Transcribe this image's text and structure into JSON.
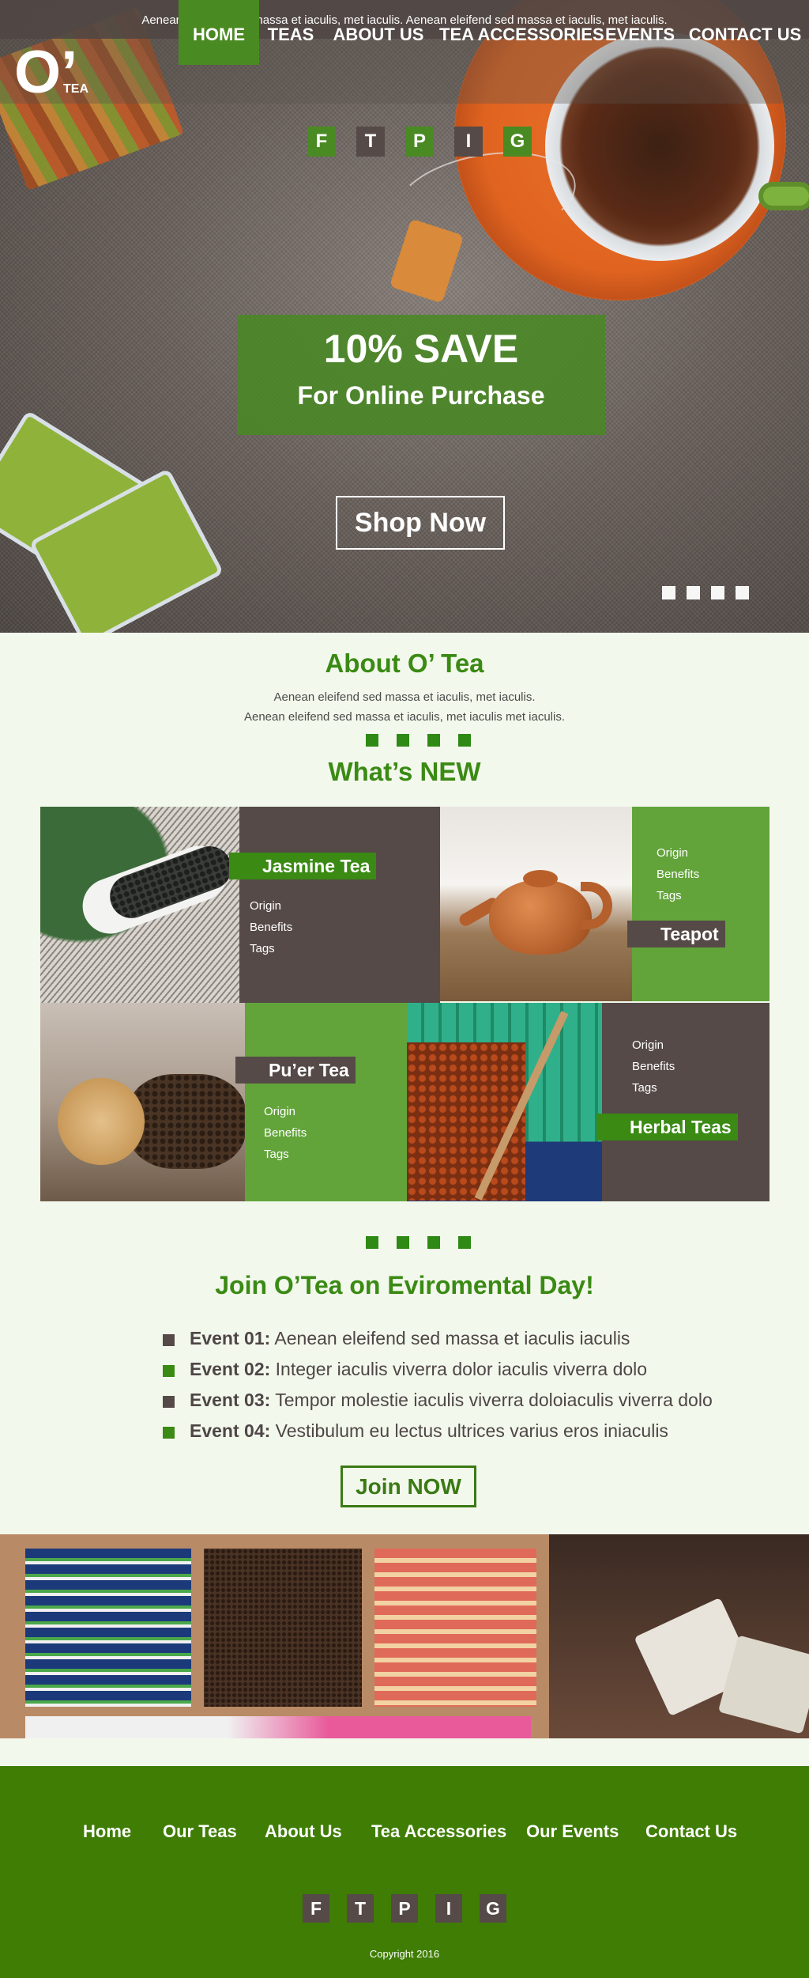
{
  "topbar": {
    "text": "Aenean eleifend sed massa et iaculis, met iaculis. Aenean eleifend sed massa et iaculis, met iaculis."
  },
  "logo": {
    "mark": "O’",
    "word": "TEA"
  },
  "nav": [
    "HOME",
    "TEAS",
    "ABOUT US",
    "TEA ACCESSORIES",
    "EVENTS",
    "CONTACT US"
  ],
  "nav_active": "HOME",
  "social": [
    "F",
    "T",
    "P",
    "I",
    "G"
  ],
  "hero": {
    "promo_big": "10% SAVE",
    "promo_sub": "For Online Purchase",
    "shop_button": "Shop Now",
    "slider_count": 4
  },
  "about": {
    "title": "About O’ Tea",
    "line1": "Aenean eleifend sed massa et iaculis, met iaculis.",
    "line2": "Aenean eleifend sed massa et iaculis, met iaculis met iaculis."
  },
  "whats_new": {
    "title": "What’s NEW",
    "items": [
      {
        "name": "Jasmine Tea",
        "links": [
          "Origin",
          "Benefits",
          "Tags"
        ]
      },
      {
        "name": "Teapot",
        "links": [
          "Origin",
          "Benefits",
          "Tags"
        ]
      },
      {
        "name": "Pu’er Tea",
        "links": [
          "Origin",
          "Benefits",
          "Tags"
        ]
      },
      {
        "name": "Herbal Teas",
        "links": [
          "Origin",
          "Benefits",
          "Tags"
        ]
      }
    ]
  },
  "events": {
    "title": "Join O’Tea on Eviromental Day!",
    "items": [
      {
        "label": "Event 01:",
        "text": "Aenean eleifend sed massa et iaculis iaculis"
      },
      {
        "label": "Event 02:",
        "text": "Integer iaculis viverra dolor  iaculis viverra dolo"
      },
      {
        "label": "Event 03:",
        "text": "Tempor molestie iaculis viverra doloiaculis viverra dolo"
      },
      {
        "label": "Event 04:",
        "text": "Vestibulum eu lectus ultrices varius eros iniaculis"
      }
    ],
    "join_button": "Join NOW"
  },
  "footer": {
    "nav": [
      "Home",
      "Our Teas",
      "About Us",
      "Tea Accessories",
      "Our Events",
      "Contact Us"
    ],
    "social": [
      "F",
      "T",
      "P",
      "I",
      "G"
    ],
    "copyright": "Copyright 2016"
  },
  "colors": {
    "brand_green": "#3a8a14",
    "footer_green": "#3f7d04",
    "dark_taupe": "#554a47",
    "light_bg": "#f3f8ec"
  },
  "icons": {
    "slider_dot": "square",
    "bullet": "square",
    "section_divider": "four-squares"
  }
}
